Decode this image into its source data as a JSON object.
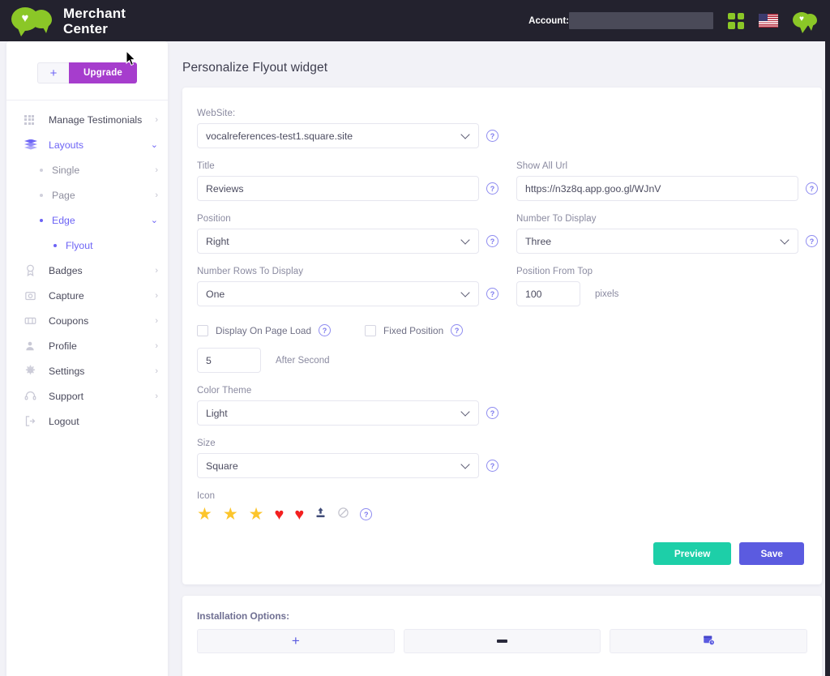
{
  "brand": {
    "line1": "Merchant",
    "line2": "Center",
    "logo_icon": "chat-heart-logo"
  },
  "topbar": {
    "account_label": "Account:",
    "account_value_redacted": "",
    "apps_icon": "grid-apps-icon",
    "flag_icon": "us-flag-icon",
    "mini_logo_icon": "chat-heart-mini-logo"
  },
  "sidebar": {
    "add_button_label": "+",
    "upgrade_button_label": "Upgrade",
    "items": [
      {
        "label": "Manage Testimonials",
        "icon": "grid-icon",
        "chevron": "›",
        "active": false
      },
      {
        "label": "Layouts",
        "icon": "layers-icon",
        "chevron": "⌄",
        "active": true
      },
      {
        "label": "Badges",
        "icon": "badge-icon",
        "chevron": "›",
        "active": false
      },
      {
        "label": "Capture",
        "icon": "capture-icon",
        "chevron": "›",
        "active": false
      },
      {
        "label": "Coupons",
        "icon": "coupon-icon",
        "chevron": "›",
        "active": false
      },
      {
        "label": "Profile",
        "icon": "user-icon",
        "chevron": "›",
        "active": false
      },
      {
        "label": "Settings",
        "icon": "gear-icon",
        "chevron": "›",
        "active": false
      },
      {
        "label": "Support",
        "icon": "headset-icon",
        "chevron": "›",
        "active": false
      },
      {
        "label": "Logout",
        "icon": "logout-icon",
        "chevron": "",
        "active": false
      }
    ],
    "layouts_children": [
      {
        "label": "Single",
        "chevron": "›",
        "active": false
      },
      {
        "label": "Page",
        "chevron": "›",
        "active": false
      },
      {
        "label": "Edge",
        "chevron": "⌄",
        "active": true
      }
    ],
    "edge_children": [
      {
        "label": "Flyout",
        "active": true
      }
    ]
  },
  "main": {
    "page_title": "Personalize Flyout widget",
    "fields": {
      "website": {
        "label": "WebSite:",
        "value": "vocalreferences-test1.square.site",
        "type": "select"
      },
      "title": {
        "label": "Title",
        "value": "Reviews",
        "type": "text"
      },
      "show_all_url": {
        "label": "Show All Url",
        "value": "https://n3z8q.app.goo.gl/WJnV",
        "type": "text"
      },
      "position": {
        "label": "Position",
        "value": "Right",
        "type": "select"
      },
      "number_to_display": {
        "label": "Number To Display",
        "value": "Three",
        "type": "select"
      },
      "number_rows_to_display": {
        "label": "Number Rows To Display",
        "value": "One",
        "type": "select"
      },
      "position_from_top": {
        "label": "Position From Top",
        "value": "100",
        "unit": "pixels",
        "type": "text"
      },
      "display_on_page_load": {
        "label": "Display On Page Load",
        "checked": false
      },
      "fixed_position": {
        "label": "Fixed Position",
        "checked": false
      },
      "after_second": {
        "value": "5",
        "unit": "After Second"
      },
      "color_theme": {
        "label": "Color Theme",
        "value": "Light",
        "type": "select"
      },
      "size": {
        "label": "Size",
        "value": "Square",
        "type": "select"
      },
      "icon": {
        "label": "Icon"
      }
    },
    "icon_choices": [
      {
        "name": "star-icon",
        "glyph": "★",
        "color": "#fcc52c"
      },
      {
        "name": "star-icon",
        "glyph": "★",
        "color": "#fcc52c"
      },
      {
        "name": "star-icon",
        "glyph": "★",
        "color": "#fcc52c"
      },
      {
        "name": "heart-icon",
        "glyph": "♥",
        "color": "#f32020"
      },
      {
        "name": "heart-icon",
        "glyph": "♥",
        "color": "#f32020"
      },
      {
        "name": "upload-icon",
        "glyph": "↥",
        "color": "#3f4a77"
      },
      {
        "name": "no-icon",
        "glyph": "⦸",
        "color": "#c3c3cd"
      }
    ],
    "help_glyph": "?",
    "buttons": {
      "preview": "Preview",
      "save": "Save"
    },
    "installation": {
      "title": "Installation Options:",
      "add_label": "+",
      "remove_label": "−",
      "schedule_icon": "calendar-clock-icon"
    }
  },
  "colors": {
    "topbar_bg": "#23222e",
    "accent_indigo": "#5b5be0",
    "accent_purple": "#a63dcd",
    "accent_green": "#8bc727",
    "accent_teal": "#1dcfa8",
    "star_yellow": "#fcc52c",
    "heart_red": "#f32020",
    "page_bg": "#f2f2f7"
  }
}
